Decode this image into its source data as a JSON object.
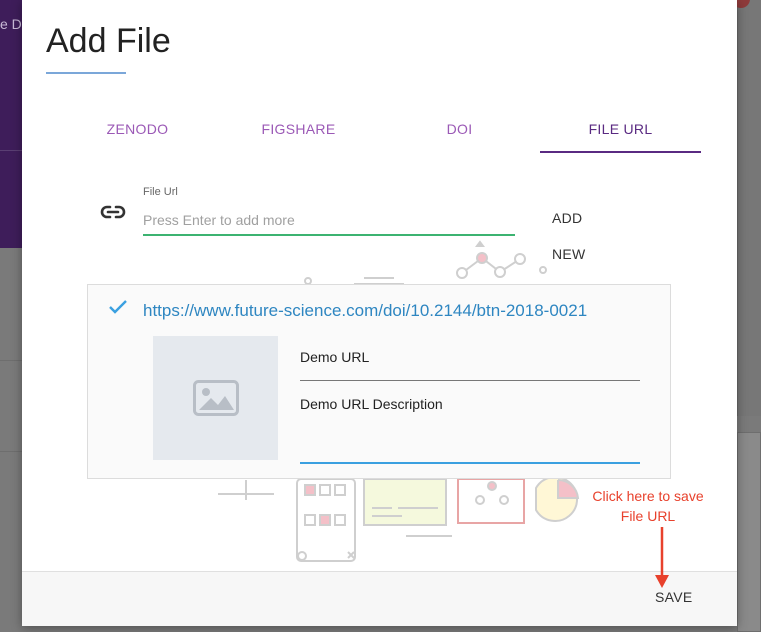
{
  "background": {
    "partial_text": "e D"
  },
  "dialog": {
    "title": "Add File",
    "tabs": [
      {
        "label": "ZENODO",
        "active": false
      },
      {
        "label": "FIGSHARE",
        "active": false
      },
      {
        "label": "DOI",
        "active": false
      },
      {
        "label": "FILE URL",
        "active": true
      }
    ],
    "file_url_field": {
      "label": "File Url",
      "placeholder": "Press Enter to add more",
      "value": "",
      "icon": "link-icon"
    },
    "add_new_button": {
      "line1": "ADD",
      "line2": "NEW"
    },
    "file_card": {
      "status_icon": "check-icon",
      "url": "https://www.future-science.com/doi/10.2144/btn-2018-0021",
      "thumbnail_icon": "image-placeholder-icon",
      "title": "Demo URL",
      "description": "Demo URL Description"
    },
    "footer": {
      "save_label": "SAVE"
    }
  },
  "annotation": {
    "text_line1": "Click here to save",
    "text_line2": "File URL",
    "color": "#e8412c"
  },
  "colors": {
    "tab_active": "#5a2a82",
    "tab_inactive": "#9b59b6",
    "input_underline": "#3cb371",
    "link": "#2e86c1",
    "description_underline": "#3aa0e0"
  }
}
